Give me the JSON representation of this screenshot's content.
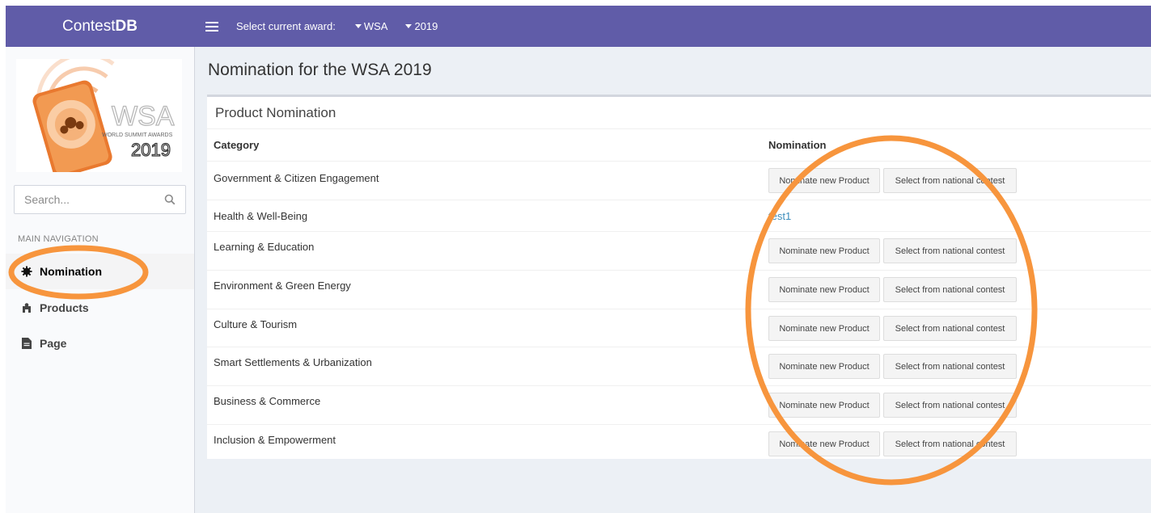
{
  "topbar": {
    "brand_light": "Contest",
    "brand_bold": "DB",
    "award_label": "Select current award:",
    "award_value": "WSA",
    "year_value": "2019"
  },
  "sidebar": {
    "logo": {
      "word": "WSA",
      "sub": "WORLD SUMMIT AWARDS",
      "year": "2019"
    },
    "search": {
      "placeholder": "Search..."
    },
    "nav_header": "MAIN NAVIGATION",
    "items": [
      {
        "label": "Nomination",
        "icon": "gear-icon",
        "active": true
      },
      {
        "label": "Products",
        "icon": "puzzle-icon",
        "active": false
      },
      {
        "label": "Page",
        "icon": "file-icon",
        "active": false
      }
    ]
  },
  "main": {
    "page_title": "Nomination for the WSA 2019",
    "box_title": "Product Nomination",
    "columns": [
      "Category",
      "Nomination"
    ],
    "buttons": {
      "new": "Nominate new Product",
      "select": "Select from national contest"
    },
    "rows": [
      {
        "category": "Government & Citizen Engagement",
        "nomination": null
      },
      {
        "category": "Health & Well-Being",
        "nomination": "test1"
      },
      {
        "category": "Learning & Education",
        "nomination": null
      },
      {
        "category": "Environment & Green Energy",
        "nomination": null
      },
      {
        "category": "Culture & Tourism",
        "nomination": null
      },
      {
        "category": "Smart Settlements & Urbanization",
        "nomination": null
      },
      {
        "category": "Business & Commerce",
        "nomination": null
      },
      {
        "category": "Inclusion & Empowerment",
        "nomination": null
      }
    ]
  },
  "colors": {
    "header": "#605ca8",
    "annotation": "#f7953d",
    "link": "#3c8dbc"
  }
}
